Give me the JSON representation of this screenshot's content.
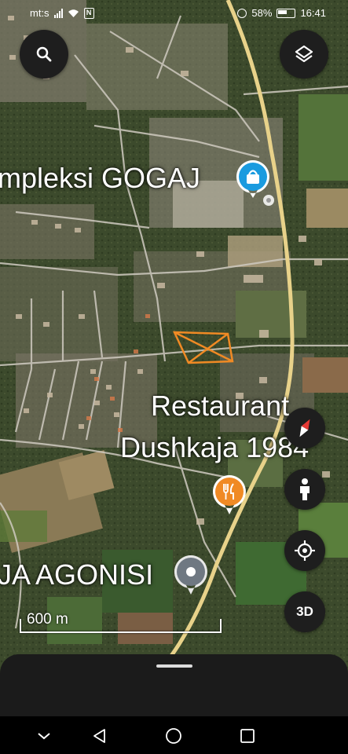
{
  "status_bar": {
    "carrier": "mt:s",
    "battery": "58%",
    "time": "16:41"
  },
  "map": {
    "labels": {
      "place_gogaj": "mpleksi GOGAJ",
      "restaurant_line1": "Restaurant",
      "restaurant_line2": "Dushkaja 1984",
      "place_agonisi": "JA AGONISI"
    },
    "scale": "600 m"
  },
  "buttons": {
    "three_d": "3D"
  },
  "icons": {
    "search": "search-icon",
    "layers": "layers-icon",
    "compass": "compass-icon",
    "street_view": "pegman-icon",
    "my_location": "my-location-icon",
    "shopping": "shopping-bag-icon",
    "restaurant": "fork-knife-icon",
    "place": "place-pin-icon"
  },
  "colors": {
    "road": "#e8d28a",
    "pin_blue": "#1a9bdf",
    "pin_orange": "#f08a24",
    "marked_area": "#f08a24",
    "control_bg": "#1e1e1e"
  }
}
